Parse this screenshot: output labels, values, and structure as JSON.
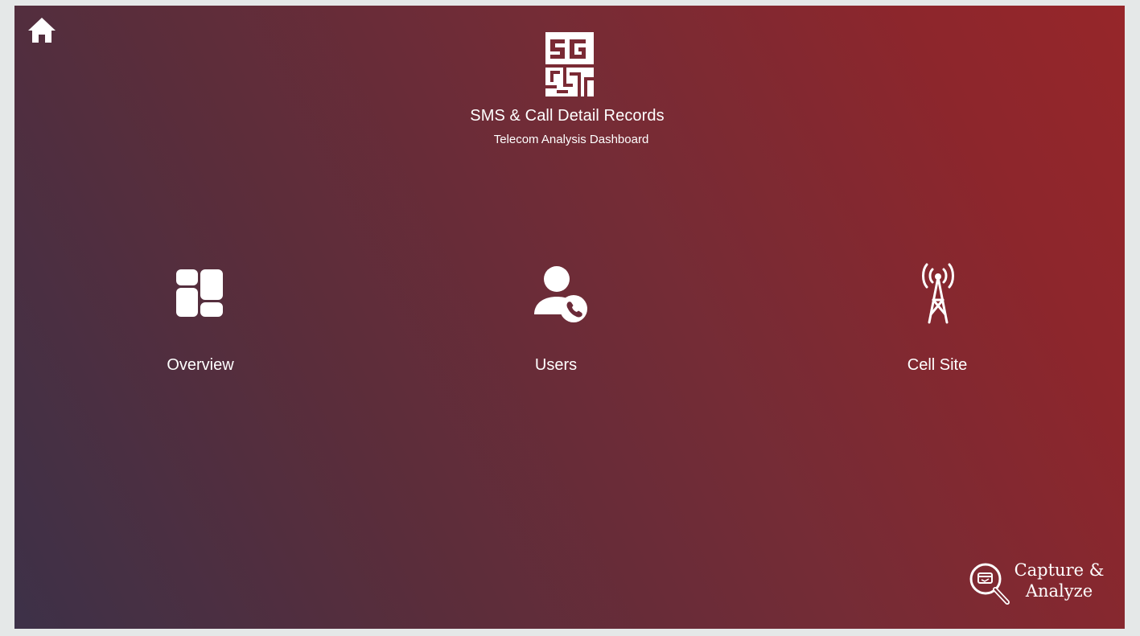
{
  "header": {
    "title": "SMS & Call Detail Records",
    "subtitle": "Telecom Analysis Dashboard",
    "logo_icon": "5g-chip-logo",
    "home_icon": "home-icon"
  },
  "tiles": [
    {
      "label": "Overview",
      "icon": "dashboard-grid-icon"
    },
    {
      "label": "Users",
      "icon": "user-call-icon"
    },
    {
      "label": "Cell Site",
      "icon": "cell-tower-icon"
    }
  ],
  "capture": {
    "line1": "Capture &",
    "line2": "Analyze",
    "icon": "magnifier-capture-icon"
  },
  "colors": {
    "background_start": "#3d3148",
    "background_end": "#96262a",
    "foreground": "#ffffff",
    "page_frame": "#e5e8e8"
  }
}
